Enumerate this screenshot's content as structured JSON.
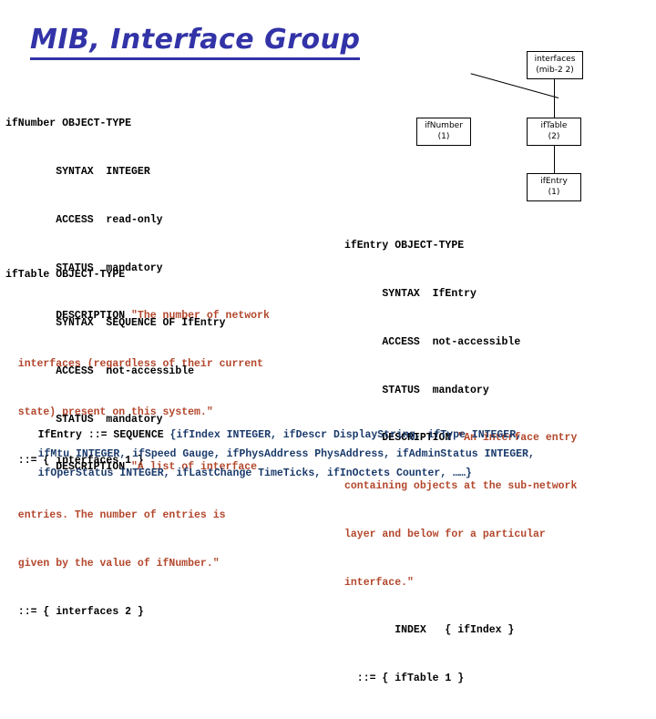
{
  "slide": {
    "title": "MIB, Interface Group",
    "title_color": "#3333a8",
    "background": "#ffffff",
    "description_color": "#b3472c",
    "sequence_color": "#1a3a6b"
  },
  "tree": {
    "nodes": [
      {
        "id": "interfaces",
        "label": "interfaces",
        "sublabel": "(mib-2 2)"
      },
      {
        "id": "ifNumber",
        "label": "ifNumber",
        "sublabel": "(1)"
      },
      {
        "id": "ifTable",
        "label": "ifTable",
        "sublabel": "(2)"
      },
      {
        "id": "ifEntry",
        "label": "ifEntry",
        "sublabel": "(1)"
      }
    ],
    "edges": [
      {
        "from": "interfaces",
        "to": "ifNumber"
      },
      {
        "from": "interfaces",
        "to": "ifTable"
      },
      {
        "from": "ifTable",
        "to": "ifEntry"
      }
    ]
  },
  "definitions": {
    "ifNumber": {
      "header": "ifNumber OBJECT-TYPE",
      "syntax": "        SYNTAX  INTEGER",
      "access": "        ACCESS  read-only",
      "status": "        STATUS  mandatory",
      "description_label": "        DESCRIPTION ",
      "description_line1": "\"The number of network",
      "description_line2": "  interfaces (regardless of their current",
      "description_line3": "  state) present on this system.\"",
      "oid": "  ::= { interfaces 1 }"
    },
    "ifTable": {
      "header": "ifTable OBJECT-TYPE",
      "syntax": "        SYNTAX  SEQUENCE OF IfEntry",
      "access": "        ACCESS  not-accessible",
      "status": "        STATUS  mandatory",
      "description_label": "        DESCRIPTION ",
      "description_line1": "\"A list of interface",
      "description_line2": "  entries. The number of entries is",
      "description_line3": "  given by the value of ifNumber.\"",
      "oid": "  ::= { interfaces 2 }"
    },
    "ifEntry": {
      "header": "ifEntry OBJECT-TYPE",
      "syntax": "      SYNTAX  IfEntry",
      "access": "      ACCESS  not-accessible",
      "status": "      STATUS  mandatory",
      "description_label": "      DESCRIPTION ",
      "description_line1": "\"An interface entry",
      "description_line2": "containing objects at the sub-network",
      "description_line3": "layer and below for a particular",
      "description_line4": "interface.\"",
      "index": "        INDEX   { ifIndex }",
      "oid": "  ::= { ifTable 1 }"
    }
  },
  "sequence": {
    "line1_black": "IfEntry ::= SEQUENCE ",
    "line1_blue": "{ifIndex INTEGER, ifDescr DisplayString, ifType INTEGER,",
    "line2": "ifMtu INTEGER, ifSpeed Gauge, ifPhysAddress PhysAddress, ifAdminStatus INTEGER,",
    "line3": "ifOperStatus INTEGER, ifLastChange TimeTicks, ifInOctets Counter, ……}"
  }
}
